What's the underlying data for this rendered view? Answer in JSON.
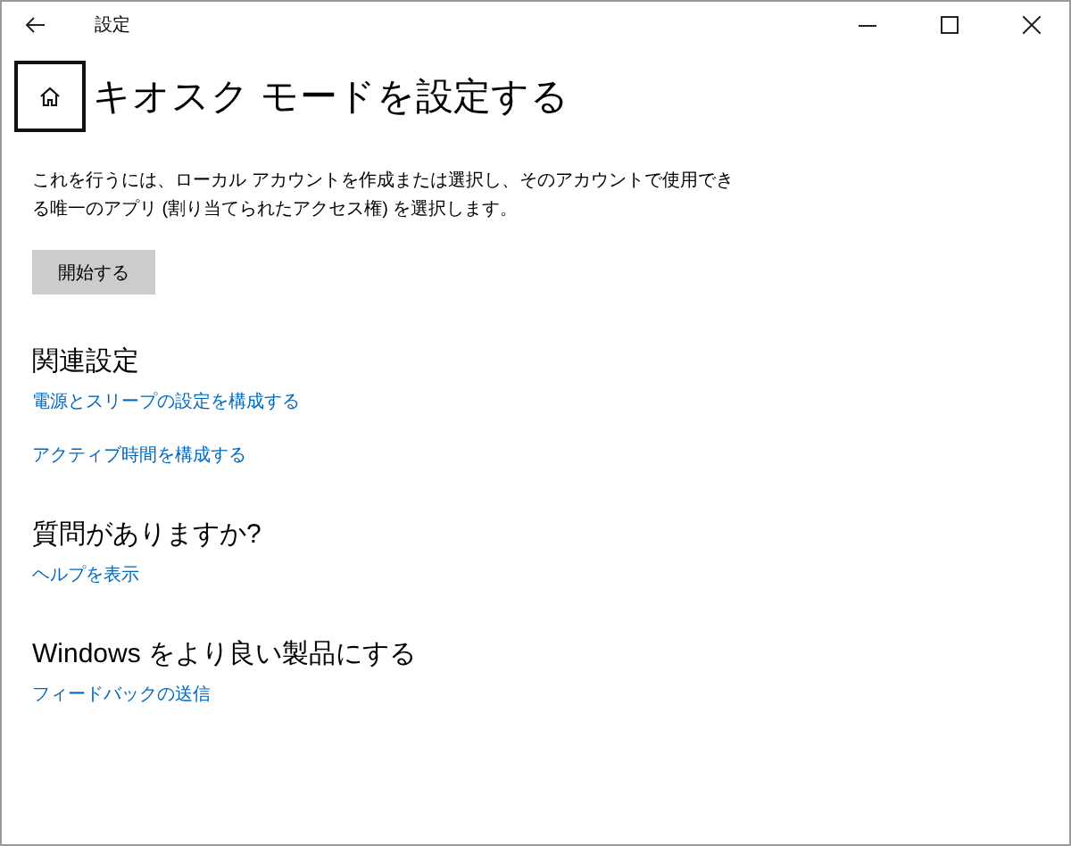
{
  "window": {
    "title": "設定"
  },
  "page": {
    "title": "キオスク モードを設定する",
    "description": "これを行うには、ローカル アカウントを作成または選択し、そのアカウントで使用できる唯一のアプリ (割り当てられたアクセス権) を選択します。",
    "button": "開始する"
  },
  "sections": [
    {
      "heading": "関連設定",
      "links": [
        "電源とスリープの設定を構成する",
        "アクティブ時間を構成する"
      ]
    },
    {
      "heading": "質問がありますか?",
      "links": [
        "ヘルプを表示"
      ]
    },
    {
      "heading": "Windows をより良い製品にする",
      "links": [
        "フィードバックの送信"
      ]
    }
  ]
}
